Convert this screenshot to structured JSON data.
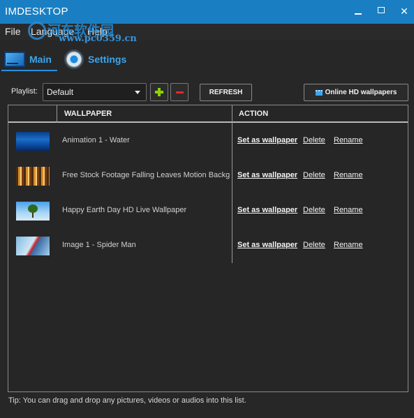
{
  "window": {
    "title": "IMDESKTOP",
    "min_glyph": "—",
    "max_glyph": "☐",
    "close_glyph": "✕"
  },
  "menu": {
    "items": [
      "File",
      "Language",
      "Help"
    ]
  },
  "watermark": {
    "text_cn": "河东软件园",
    "url": "www.pc0359.cn"
  },
  "tabs": [
    {
      "label": "Main",
      "icon": "monitor-icon",
      "active": true
    },
    {
      "label": "Settings",
      "icon": "gear-icon",
      "active": false
    }
  ],
  "toolbar": {
    "playlist_label": "Playlist:",
    "playlist_value": "Default",
    "add_icon": "plus-icon",
    "remove_icon": "minus-icon",
    "refresh_label": "REFRESH",
    "online_label": "Online HD wallpapers",
    "online_icon": "film-icon"
  },
  "grid": {
    "columns": [
      "WALLPAPER",
      "ACTION"
    ],
    "rows": [
      {
        "name": "Animation 1 - Water",
        "thumb": "water-thumbnail"
      },
      {
        "name": "Free Stock Footage Falling Leaves Motion Backg",
        "thumb": "leaves-thumbnail"
      },
      {
        "name": "Happy Earth Day HD Live Wallpaper",
        "thumb": "earth-thumbnail"
      },
      {
        "name": "Image 1 - Spider Man",
        "thumb": "spiderman-thumbnail"
      }
    ],
    "actions": {
      "set": "Set as wallpaper",
      "delete": "Delete",
      "rename": "Rename"
    }
  },
  "tip": "Tip: You can drag and drop any pictures, videos or audios into this list.",
  "colors": {
    "accent": "#1a7fc2",
    "tab_text": "#3aa6ef",
    "background": "#272727",
    "add": "#8bd400",
    "remove": "#e22a2a"
  }
}
